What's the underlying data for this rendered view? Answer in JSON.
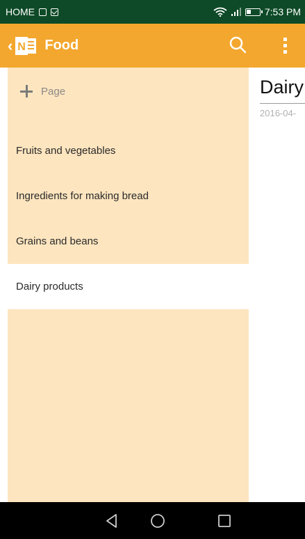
{
  "statusbar": {
    "carrier": "HOME",
    "time": "7:53 PM"
  },
  "appbar": {
    "back_icon": "chevron-left-icon",
    "logo_letter": "N",
    "title": "Food",
    "search_icon": "search-icon",
    "more_icon": "more-vertical-icon"
  },
  "pages_pane": {
    "add_page_label": "Page",
    "pages": [
      {
        "label": "Fruits and vegetables",
        "selected": false
      },
      {
        "label": "Ingredients for making bread",
        "selected": false
      },
      {
        "label": "Grains and beans",
        "selected": false
      },
      {
        "label": "Dairy products",
        "selected": true
      }
    ]
  },
  "note": {
    "title": "Dairy",
    "date": "2016-04-"
  },
  "colors": {
    "statusbar": "#0e4a27",
    "appbar": "#f3a72e",
    "pane": "#fde5bf",
    "selected": "#ffffff"
  }
}
